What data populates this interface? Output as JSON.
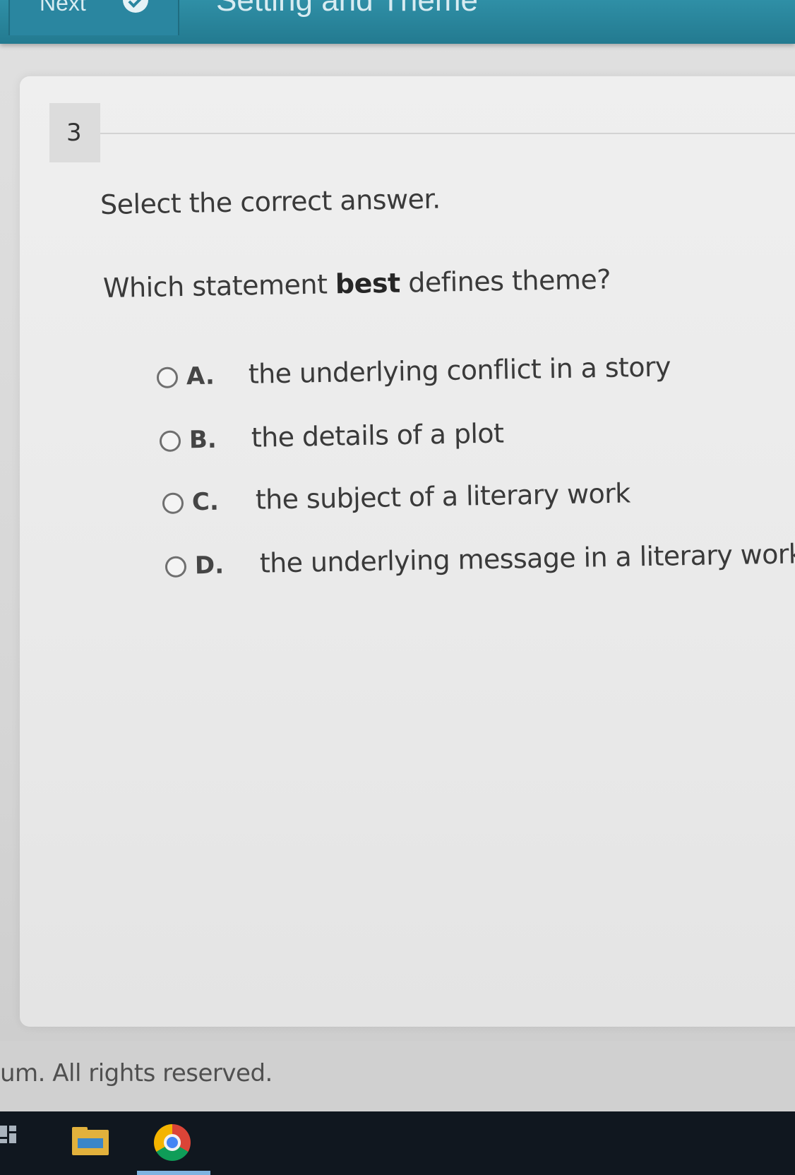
{
  "header": {
    "next_label": "Next",
    "title": "Setting and Theme"
  },
  "question": {
    "number": "3",
    "instruction": "Select the correct answer.",
    "prompt_before": "Which statement ",
    "prompt_bold": "best",
    "prompt_after": " defines theme?",
    "options": [
      {
        "letter": "A.",
        "text": "the underlying conflict in a story"
      },
      {
        "letter": "B.",
        "text": "the details of a plot"
      },
      {
        "letter": "C.",
        "text": "the subject of a literary work"
      },
      {
        "letter": "D.",
        "text": "the underlying message in a literary work"
      }
    ],
    "selected": null
  },
  "footer": {
    "copyright": "um. All rights reserved."
  },
  "taskbar": {
    "items": [
      "task-view-icon",
      "file-explorer-icon",
      "chrome-icon"
    ]
  },
  "colors": {
    "header_bar": "#2f8fa6",
    "card_background": "#efefef",
    "taskbar": "#10171f"
  }
}
